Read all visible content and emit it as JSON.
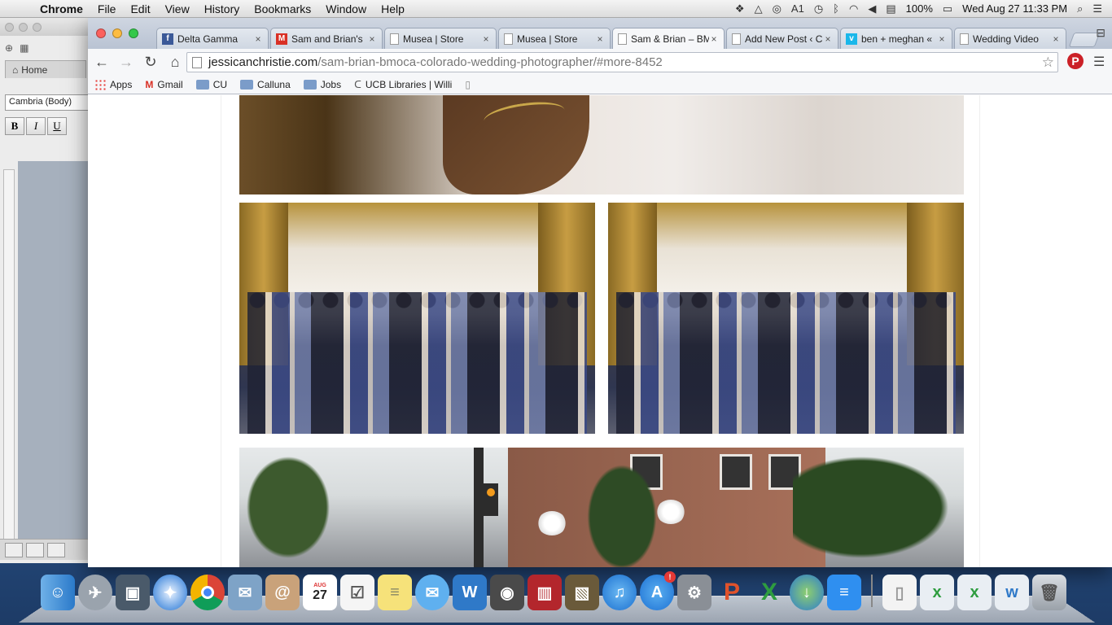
{
  "menubar": {
    "app": "Chrome",
    "items": [
      "File",
      "Edit",
      "View",
      "History",
      "Bookmarks",
      "Window",
      "Help"
    ],
    "status": {
      "notifications": "1",
      "battery": "100%",
      "datetime": "Wed Aug 27  11:33 PM"
    }
  },
  "word": {
    "home_tab": "Home",
    "font": "Cambria (Body)",
    "bold": "B",
    "italic": "I",
    "underline": "U"
  },
  "chrome": {
    "tabs": [
      {
        "title": "Delta Gamma",
        "icon": "facebook-icon",
        "color": "#3b5998",
        "glyph": "f"
      },
      {
        "title": "Sam and Brian's",
        "icon": "gmail-icon",
        "color": "#d93025",
        "glyph": "M"
      },
      {
        "title": "Musea | Store",
        "icon": "page-icon",
        "color": "#ffffff",
        "glyph": ""
      },
      {
        "title": "Musea | Store",
        "icon": "page-icon",
        "color": "#ffffff",
        "glyph": ""
      },
      {
        "title": "Sam & Brian – BM",
        "icon": "page-icon",
        "color": "#ffffff",
        "glyph": "",
        "active": true
      },
      {
        "title": "Add New Post ‹ C",
        "icon": "page-icon",
        "color": "#ffffff",
        "glyph": ""
      },
      {
        "title": "ben + meghan «",
        "icon": "vimeo-icon",
        "color": "#1ab7ea",
        "glyph": "v"
      },
      {
        "title": "Wedding Video",
        "icon": "page-icon",
        "color": "#ffffff",
        "glyph": ""
      }
    ],
    "url_host": "jessicanchristie.com",
    "url_path": "/sam-brian-bmoca-colorado-wedding-photographer/#more-8452",
    "bookmarks": [
      {
        "label": "Apps",
        "icon": "apps-grid-icon"
      },
      {
        "label": "Gmail",
        "icon": "gmail-icon"
      },
      {
        "label": "CU",
        "icon": "folder-icon"
      },
      {
        "label": "Calluna",
        "icon": "folder-icon"
      },
      {
        "label": "Jobs",
        "icon": "folder-icon"
      },
      {
        "label": "UCB Libraries | Willi",
        "icon": "ucb-icon"
      },
      {
        "label": "",
        "icon": "page-icon"
      }
    ]
  },
  "dock": {
    "calendar_day": "27",
    "calendar_month": "AUG",
    "appstore_badge": "!"
  },
  "colors": {
    "accent_pinterest": "#cb2027",
    "menubar_bg": "#e8e8e8",
    "tabstrip_bg": "#c4cddb"
  }
}
